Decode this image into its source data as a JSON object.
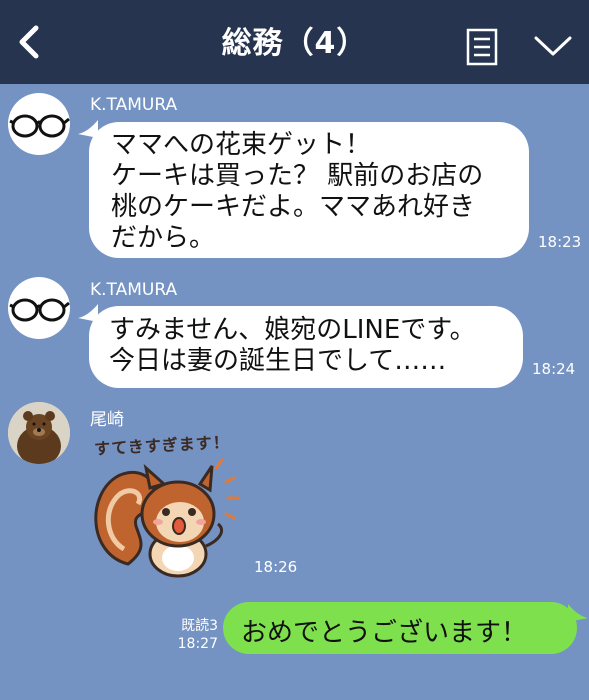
{
  "header": {
    "title": "総務（4）"
  },
  "messages": [
    {
      "sender": "K.TAMURA",
      "text": "ママへの花束ゲット！\nケーキは買った？ 駅前のお店の\n桃のケーキだよ。ママあれ好き\nだから。",
      "time": "18:23"
    },
    {
      "sender": "K.TAMURA",
      "text": "すみません、娘宛のLINEです。\n今日は妻の誕生日でして……",
      "time": "18:24"
    },
    {
      "sender": "尾崎",
      "sticker_text": "すてきすぎます！",
      "sticker_icon": "squirrel-sticker",
      "time": "18:26"
    },
    {
      "sender": "me",
      "read_label": "既読3",
      "text": "おめでとうございます！",
      "time": "18:27"
    }
  ],
  "colors": {
    "header": "#263450",
    "background": "#7493c3",
    "bubble_in": "#ffffff",
    "bubble_out": "#7ee04d"
  }
}
